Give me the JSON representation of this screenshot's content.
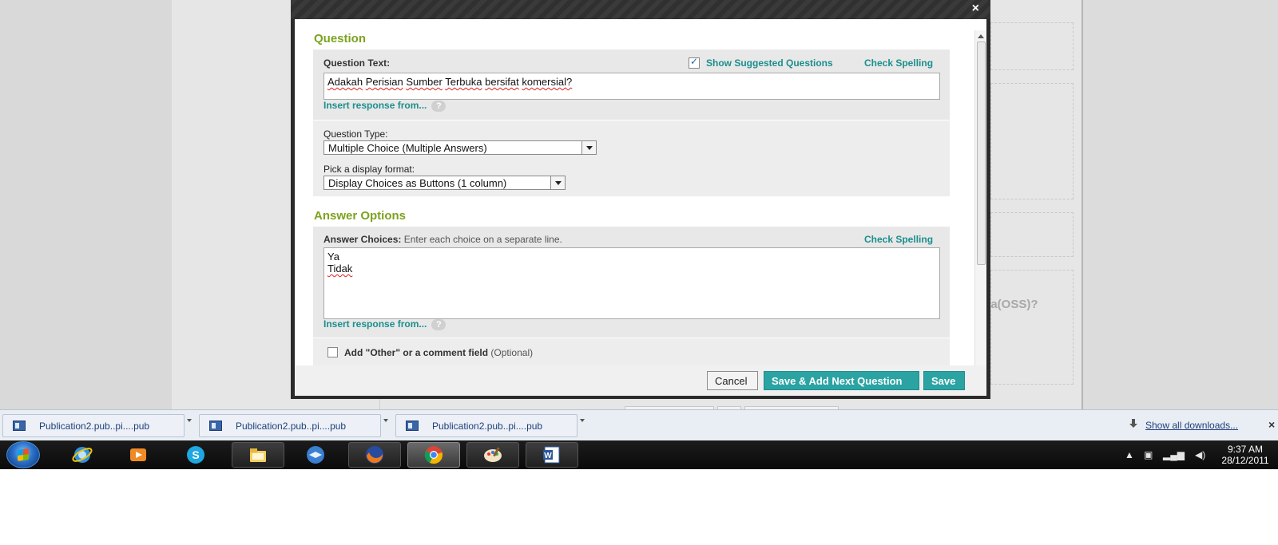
{
  "background_page": {
    "partial_question_text": "ka(OSS)?"
  },
  "modal": {
    "close_label": "×",
    "question_section": {
      "title": "Question",
      "question_text_label": "Question Text:",
      "show_suggested_label": "Show Suggested Questions",
      "show_suggested_checked": true,
      "check_spelling_label": "Check Spelling",
      "question_text_value_parts": [
        "Adakah",
        "Perisian",
        "Sumber",
        "Terbuka",
        "bersifat",
        "komersial?"
      ],
      "insert_response_label": "Insert response from...",
      "help_label": "?",
      "question_type_label": "Question Type:",
      "question_type_value": "Multiple Choice (Multiple Answers)",
      "display_format_label": "Pick a display format:",
      "display_format_value": "Display Choices as Buttons (1 column)"
    },
    "answer_section": {
      "title": "Answer Options",
      "answer_choices_label": "Answer Choices:",
      "answer_choices_hint": "Enter each choice on a separate line.",
      "check_spelling_label": "Check Spelling",
      "choices": [
        "Ya",
        "Tidak"
      ],
      "insert_response_label": "Insert response from...",
      "help_label": "?",
      "other_comment_label": "Add \"Other\" or a comment field",
      "other_comment_optional": "(Optional)",
      "other_comment_checked": false
    },
    "footer": {
      "cancel_label": "Cancel",
      "save_next_label": "Save & Add Next Question",
      "save_label": "Save"
    }
  },
  "downloads_bar": {
    "items": [
      {
        "name": "Publication2.pub..pi....pub"
      },
      {
        "name": "Publication2.pub..pi....pub"
      },
      {
        "name": "Publication2.pub..pi....pub"
      }
    ],
    "show_all_label": "Show all downloads...",
    "close_label": "×"
  },
  "taskbar": {
    "apps": [
      {
        "icon": "internet-explorer-icon",
        "state": "pinned"
      },
      {
        "icon": "media-player-icon",
        "state": "pinned"
      },
      {
        "icon": "skype-icon",
        "state": "pinned"
      },
      {
        "icon": "file-explorer-icon",
        "state": "open"
      },
      {
        "icon": "thunderbird-icon",
        "state": "pinned"
      },
      {
        "icon": "firefox-icon",
        "state": "open"
      },
      {
        "icon": "chrome-icon",
        "state": "active"
      },
      {
        "icon": "paint-icon",
        "state": "open"
      },
      {
        "icon": "word-icon",
        "state": "open"
      }
    ],
    "clock_time": "9:37 AM",
    "clock_date": "28/12/2011"
  },
  "colors": {
    "accent_green": "#7ca31e",
    "teal": "#2ba3a3",
    "link_teal": "#1c8e8e"
  }
}
